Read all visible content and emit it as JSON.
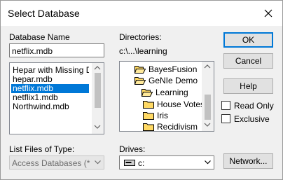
{
  "window": {
    "title": "Select Database"
  },
  "database_name": {
    "label": "Database Name",
    "value": "netflix.mdb",
    "files": [
      "Hepar with Missing Data",
      "hepar.mdb",
      "netflix.mdb",
      "netflix1.mdb",
      "Northwind.mdb"
    ],
    "selected_index": 2
  },
  "directories": {
    "label": "Directories:",
    "current_path": "c:\\...\\learning",
    "tree": [
      "BayesFusion",
      "GeNIe Demo",
      "Learning",
      "House Votes",
      "Iris",
      "Recidivism"
    ]
  },
  "file_type": {
    "label": "List Files of Type:",
    "value": "Access Databases (*.mdb)"
  },
  "drives": {
    "label": "Drives:",
    "value": "c:"
  },
  "buttons": {
    "ok": "OK",
    "cancel": "Cancel",
    "help": "Help",
    "network": "Network..."
  },
  "options": {
    "read_only": {
      "label": "Read Only",
      "checked": false
    },
    "exclusive": {
      "label": "Exclusive",
      "checked": false
    }
  },
  "colors": {
    "selection": "#0078d7",
    "folder": "#ffd964"
  }
}
